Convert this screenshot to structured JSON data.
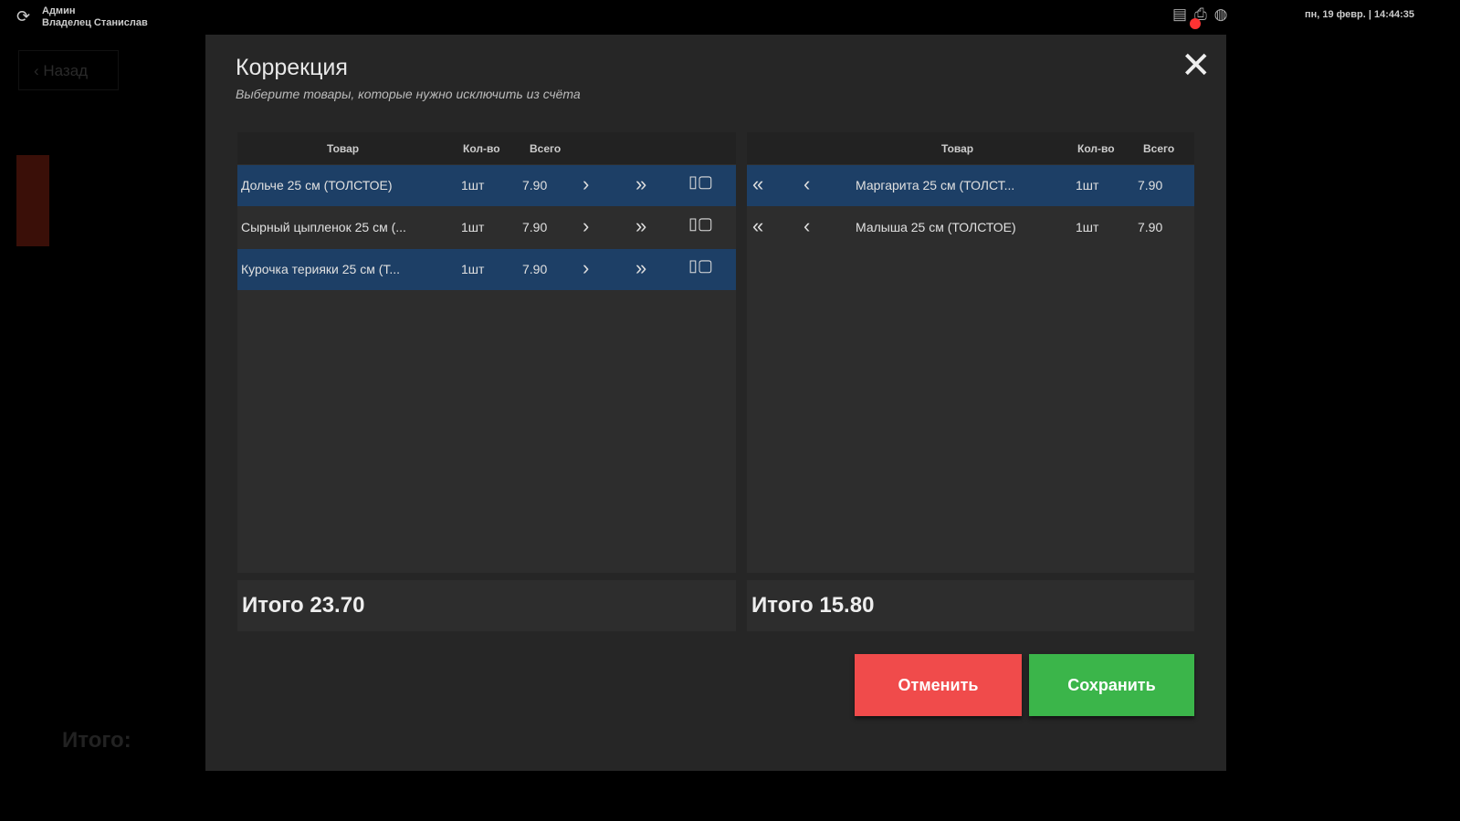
{
  "topbar": {
    "role": "Админ",
    "user": "Владелец Станислав",
    "datetime": "пн, 19 февр. | 14:44:35"
  },
  "background": {
    "back_label": "Назад",
    "total_label": "Итого:"
  },
  "modal": {
    "title": "Коррекция",
    "subtitle": "Выберите товары, которые нужно исключить из счёта",
    "columns": {
      "product": "Товар",
      "qty": "Кол-во",
      "total": "Всего"
    },
    "left_items": [
      {
        "name": "Дольче 25 см (ТОЛСТОЕ)",
        "qty": "1шт",
        "total": "7.90",
        "selected": true
      },
      {
        "name": "Сырный цыпленок 25 см (...",
        "qty": "1шт",
        "total": "7.90",
        "selected": false
      },
      {
        "name": "Курочка терияки 25 см (Т...",
        "qty": "1шт",
        "total": "7.90",
        "selected": true
      }
    ],
    "right_items": [
      {
        "name": "Маргарита 25 см (ТОЛСТ...",
        "qty": "1шт",
        "total": "7.90",
        "selected": true
      },
      {
        "name": "Малыша 25 см (ТОЛСТОЕ)",
        "qty": "1шт",
        "total": "7.90",
        "selected": false
      }
    ],
    "left_total": "Итого 23.70",
    "right_total": "Итого 15.80",
    "cancel_label": "Отменить",
    "save_label": "Сохранить"
  }
}
